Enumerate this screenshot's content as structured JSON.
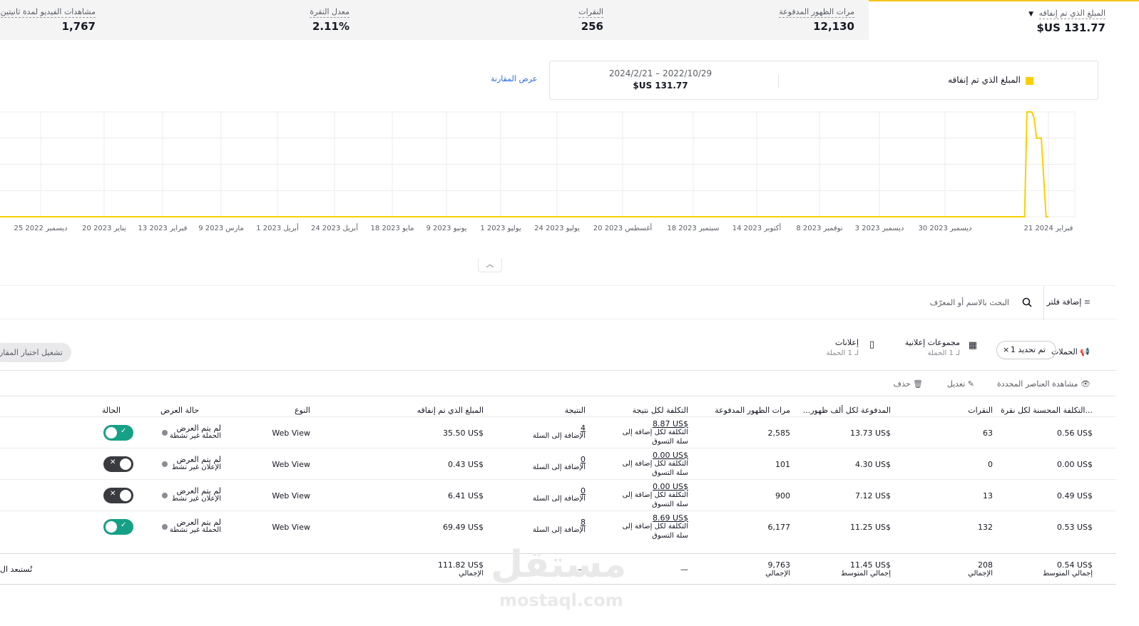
{
  "metrics": [
    {
      "label": "المبلغ الذي تم إنفاقه",
      "value": "$US 131.77"
    },
    {
      "label": "مرات الظهور المدفوعة",
      "value": "12,130"
    },
    {
      "label": "النقرات",
      "value": "256"
    },
    {
      "label": "معدل النقرة",
      "value": "2.11%"
    },
    {
      "label": "مشاهدات الفيديو لمدة ثانيتين",
      "value": "1,767"
    }
  ],
  "legend": {
    "metric": "المبلغ الذي تم إنفاقه",
    "swatch_color": "#f8d000",
    "range": "2024/2/21 – 2022/10/29",
    "total": "$US 131.77",
    "compare_link": "عرض المقارنة"
  },
  "chart_data": {
    "type": "line",
    "x_ticks": [
      "25 ديسمبر 2022",
      "20 يناير 2023",
      "13 فبراير 2023",
      "9 مارس 2023",
      "1 أبريل 2023",
      "24 أبريل 2023",
      "18 مايو 2023",
      "9 يونيو 2023",
      "1 يوليو 2023",
      "24 يوليو 2023",
      "20 أغسطس 2023",
      "18 سبتمبر 2023",
      "14 أكتوبر 2023",
      "8 نوفمبر 2023",
      "3 ديسمبر 2023",
      "30 ديسمبر 2023",
      "21 فبراير 2024"
    ],
    "series": [
      {
        "color": "#f8d000",
        "points": [
          {
            "x": "2022-10-29",
            "y": 0
          },
          {
            "x": "2024-02-11",
            "y": 0
          },
          {
            "x": "2024-02-12",
            "y": 1.0
          },
          {
            "x": "2024-02-14",
            "y": 1.0
          },
          {
            "x": "2024-02-15",
            "y": 0.94
          },
          {
            "x": "2024-02-16",
            "y": 0.75
          },
          {
            "x": "2024-02-18",
            "y": 0.75
          },
          {
            "x": "2024-02-20",
            "y": 0
          },
          {
            "x": "2024-02-21",
            "y": 0
          }
        ]
      }
    ],
    "grid": true
  },
  "filter": {
    "add_filter": "إضافة فلتر",
    "search_placeholder": "البحث بالاسم أو المعرّف"
  },
  "tabs": {
    "campaigns": "الحملات",
    "chip": "تم تحديد 1",
    "ad_groups": {
      "title": "مجموعات إعلانية",
      "sub": "لـ 1 الحملة"
    },
    "ads": {
      "title": "إعلانات",
      "sub": "لـ 1 الحملة"
    },
    "ab_test": "تشغيل اختبار المقارنة"
  },
  "actions": {
    "view_selected": "مشاهدة العناصر المحددة",
    "edit": "تعديل",
    "delete": "حذف"
  },
  "table": {
    "headers": {
      "cpc": "التكلفة المحسنة لكل نقرة...",
      "clicks": "النقرات",
      "cpm": "...المدفوعة لكل ألف ظهور",
      "impressions": "مرات الظهور المدفوعة",
      "cost_per_result": "التكلفة لكل نتيجة",
      "result": "النتيجة",
      "spend": "المبلغ الذي تم إنفاقه",
      "type": "النوع",
      "delivery": "حالة العرض",
      "status": "الحالة"
    },
    "rows": [
      {
        "cpc": "0.56 US$",
        "clicks": "63",
        "cpm": "13.73 US$",
        "impressions": "2,585",
        "cpr": "8.87 US$",
        "cpr_sub1": "التكلفة لكل إضافة إلى",
        "cpr_sub2": "سلة التسوق",
        "result": "4",
        "result_sub": "الإضافة إلى السلة",
        "spend": "35.50 US$",
        "type": "Web View",
        "delivery": "لم يتم العرض",
        "delivery_sub": "الحملة غير نشطة",
        "toggle_on": true
      },
      {
        "cpc": "0.00 US$",
        "clicks": "0",
        "cpm": "4.30 US$",
        "impressions": "101",
        "cpr": "0.00 US$",
        "cpr_sub1": "التكلفة لكل إضافة إلى",
        "cpr_sub2": "سلة التسوق",
        "result": "0",
        "result_sub": "الإضافة إلى السلة",
        "spend": "0.43 US$",
        "type": "Web View",
        "delivery": "لم يتم العرض",
        "delivery_sub": "الإعلان غير نشط",
        "toggle_on": false
      },
      {
        "cpc": "0.49 US$",
        "clicks": "13",
        "cpm": "7.12 US$",
        "impressions": "900",
        "cpr": "0.00 US$",
        "cpr_sub1": "التكلفة لكل إضافة إلى",
        "cpr_sub2": "سلة التسوق",
        "result": "0",
        "result_sub": "الإضافة إلى السلة",
        "spend": "6.41 US$",
        "type": "Web View",
        "delivery": "لم يتم العرض",
        "delivery_sub": "الإعلان غير نشط",
        "toggle_on": false
      },
      {
        "cpc": "0.53 US$",
        "clicks": "132",
        "cpm": "11.25 US$",
        "impressions": "6,177",
        "cpr": "8.69 US$",
        "cpr_sub1": "التكلفة لكل إضافة إلى",
        "cpr_sub2": "سلة التسوق",
        "result": "8",
        "result_sub": "الإضافة إلى السلة",
        "spend": "69.49 US$",
        "type": "Web View",
        "delivery": "لم يتم العرض",
        "delivery_sub": "الحملة غير نشطة",
        "toggle_on": true
      }
    ],
    "totals": {
      "cpc": "0.54 US$",
      "cpc_sub": "إجمالي المتوسط",
      "clicks": "208",
      "clicks_sub": "الإجمالي",
      "cpm": "11.45 US$",
      "cpm_sub": "إجمالي المتوسط",
      "impressions": "9,763",
      "impressions_sub": "الإجمالي",
      "cpr": "—",
      "result": "—",
      "spend": "111.82 US$",
      "spend_sub": "الإجمالي",
      "excluded": "تُستبعد ال"
    }
  },
  "watermark": {
    "main": "مستقل",
    "sub": "mostaql.com"
  }
}
